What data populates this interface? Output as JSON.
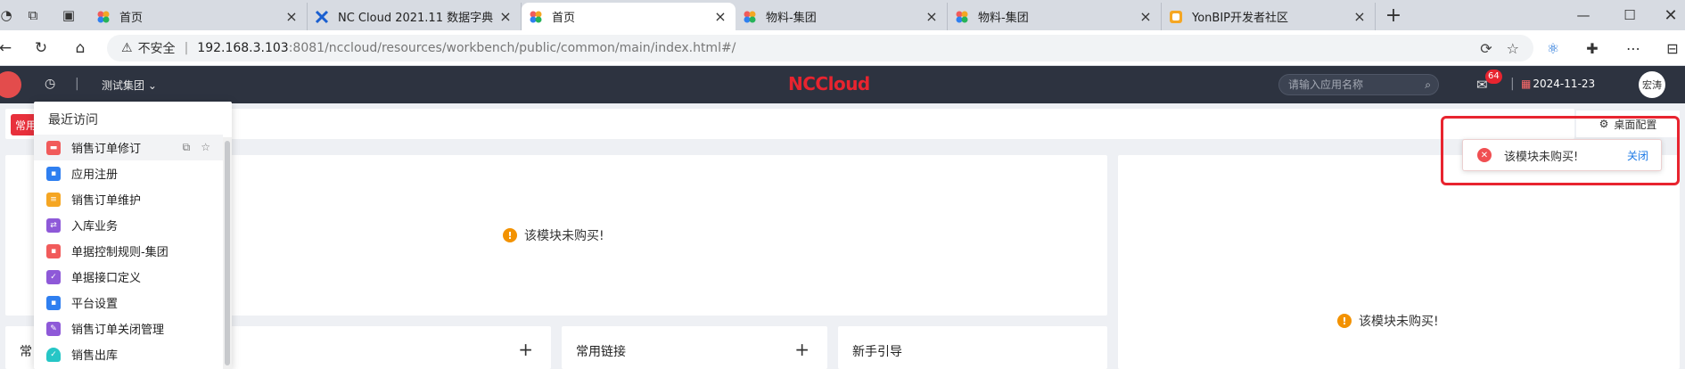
{
  "browser": {
    "tabs": [
      {
        "label": "首页",
        "active": false
      },
      {
        "label": "NC Cloud 2021.11 数据字典",
        "active": false
      },
      {
        "label": "首页",
        "active": true
      },
      {
        "label": "物料-集团",
        "active": false
      },
      {
        "label": "物料-集团",
        "active": false
      },
      {
        "label": "YonBIP开发者社区",
        "active": false
      }
    ],
    "new_tab": "+",
    "address": {
      "security_label": "不安全",
      "host": "192.168.3.103",
      "path": ":8081/nccloud/resources/workbench/public/common/main/index.html#/"
    }
  },
  "header": {
    "brand": "NCCloud",
    "group": "测试集团",
    "search_placeholder": "请输入应用名称",
    "message_count": "64",
    "date": "2024-11-23",
    "avatar_text": "宏涛"
  },
  "workbench": {
    "common_tab": "常用",
    "desktop_config": "桌面配置",
    "not_purchased": "该模块未购买!",
    "cards": [
      {
        "title": "常",
        "has_add": true
      },
      {
        "title": "常用链接",
        "has_add": true
      },
      {
        "title": "新手引导",
        "has_add": false
      }
    ]
  },
  "recent": {
    "title": "最近访问",
    "items": [
      {
        "label": "销售订单修订",
        "color": "#f15b5b"
      },
      {
        "label": "应用注册",
        "color": "#2f7ff0"
      },
      {
        "label": "销售订单维护",
        "color": "#f5a623"
      },
      {
        "label": "入库业务",
        "color": "#8e59d8"
      },
      {
        "label": "单据控制规则-集团",
        "color": "#f15b5b"
      },
      {
        "label": "单据接口定义",
        "color": "#8e59d8"
      },
      {
        "label": "平台设置",
        "color": "#2f7ff0"
      },
      {
        "label": "销售订单关闭管理",
        "color": "#8e59d8"
      },
      {
        "label": "销售出库",
        "color": "#26c6c6"
      }
    ]
  },
  "toast": {
    "message": "该模块未购买!",
    "close_label": "关闭"
  }
}
